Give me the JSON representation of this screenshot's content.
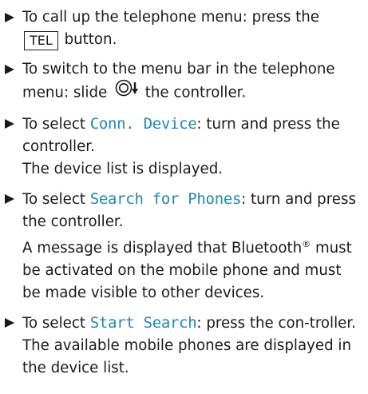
{
  "steps": [
    {
      "pre": "To call up the telephone menu: press the ",
      "key": "TEL",
      "post": " button."
    },
    {
      "pre": "To switch to the menu bar in the telephone menu: slide ",
      "post": " the controller."
    },
    {
      "pre": "To select ",
      "highlight": "Conn. Device",
      "post": ": turn and press the controller.",
      "result": "The device list is displayed."
    },
    {
      "pre": "To select ",
      "highlight": "Search for Phones",
      "post": ": turn and press the controller.",
      "result_pre": "A message is displayed that Bluetooth",
      "result_sup": "®",
      "result_post": " must be activated on the mobile phone and must be made visible to other devices."
    },
    {
      "pre": "To select ",
      "highlight": "Start Search",
      "post": ": press the con-troller.",
      "result": "The available mobile phones are displayed in the device list."
    }
  ],
  "controller_icon": "controller-slide-down-icon",
  "colors": {
    "highlight": "#1f86b8",
    "text": "#1a1a1a"
  }
}
